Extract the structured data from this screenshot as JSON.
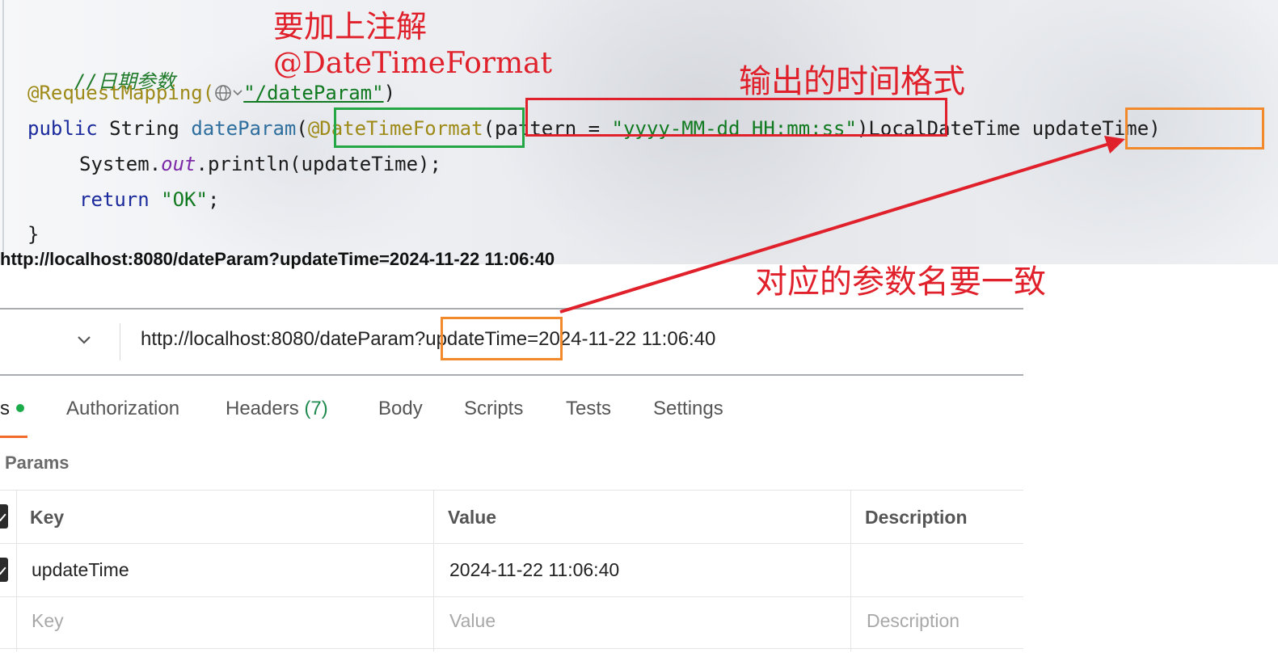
{
  "editor": {
    "comment": "//日期参数",
    "mapping_annotation": "@RequestMapping(",
    "mapping_path": "\"/dateParam\"",
    "mapping_close": ")",
    "kw_public": "public",
    "type_string": "String",
    "method_name": "dateParam",
    "paren_open": "(",
    "dtf_annotation": "@DateTimeFormat",
    "pattern_prefix": "(pattern = ",
    "pattern_value": "\"yyyy-MM-dd HH:mm:ss\"",
    "pattern_suffix": ")",
    "param_type": "LocalDateTime",
    "param_name": "updateTime",
    "param_close": ")",
    "line3_prefix": "System.",
    "line3_static": "out",
    "line3_suffix": ".println(updateTime);",
    "kw_return": "return",
    "return_value": "\"OK\"",
    "return_semi": ";",
    "closing_brace": "}"
  },
  "annotations": {
    "add_annotation_cn": "要加上注解",
    "add_annotation_name": "@DateTimeFormat",
    "output_format_cn": "输出的时间格式",
    "param_name_match_cn": "对应的参数名要一致",
    "colors": {
      "red": "#e0202a",
      "green": "#26a745",
      "orange": "#f28a2b"
    }
  },
  "request": {
    "top_url": "http://localhost:8080/dateParam?updateTime=2024-11-22 11:06:40",
    "method_dropdown_icon": "chevron-down-icon",
    "url_prefix": "http://localhost:8080/dateParam?",
    "url_param_key": "updateTime",
    "url_param_rest": "=2024-11-22 11:06:40"
  },
  "tabs": {
    "params_partial": "s",
    "authorization": "Authorization",
    "headers": "Headers",
    "headers_count": "(7)",
    "body": "Body",
    "scripts": "Scripts",
    "tests": "Tests",
    "settings": "Settings",
    "active_color": "#f36b2a"
  },
  "query_params": {
    "section_title": "Params",
    "columns": {
      "key": "Key",
      "value": "Value",
      "description": "Description"
    },
    "rows": [
      {
        "key": "updateTime",
        "value": "2024-11-22 11:06:40",
        "description": ""
      }
    ],
    "placeholder": {
      "key": "Key",
      "value": "Value",
      "description": "Description"
    }
  }
}
